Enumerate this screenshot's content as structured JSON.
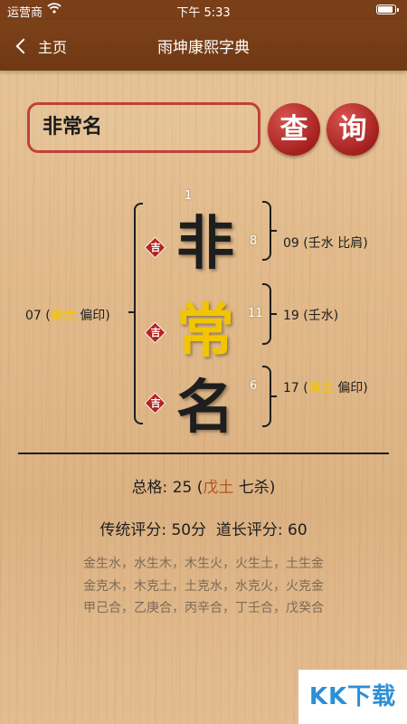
{
  "status_bar": {
    "carrier": "运营商",
    "time": "下午 5:33",
    "battery_level": 0.9
  },
  "nav": {
    "back_label": "主页",
    "title": "雨坤康熙字典"
  },
  "search": {
    "value": "非常名"
  },
  "buttons": {
    "query_1": "查",
    "query_2": "询"
  },
  "name_chars": [
    {
      "char": "非",
      "strokes": "8",
      "fortune": "吉",
      "color": "#1e1e1e"
    },
    {
      "char": "常",
      "strokes": "11",
      "fortune": "吉",
      "color": "#f2c500"
    },
    {
      "char": "名",
      "strokes": "6",
      "fortune": "吉",
      "color": "#1e1e1e"
    }
  ],
  "top_stroke": "1",
  "grids": {
    "outer": {
      "num": "07",
      "wuxing": "庚金",
      "shishen": "偏印"
    },
    "tian": {
      "num": "09",
      "wuxing": "壬水",
      "shishen": "比肩"
    },
    "ren": {
      "num": "19",
      "wuxing": "壬水"
    },
    "di": {
      "num": "17",
      "wuxing": "庚金",
      "shishen": "偏印"
    }
  },
  "total": {
    "label": "总格:",
    "num": "25",
    "wuxing": "戊土",
    "shishen": "七杀"
  },
  "scores": {
    "traditional": "传统评分: 50分",
    "daochang": "道长评分: 60"
  },
  "relations": [
    "金生水，水生木，木生火，火生土，土生金",
    "金克木，木克土，土克水，水克火，火克金",
    "甲己合，乙庚合，丙辛合，丁壬合，戊癸合"
  ],
  "watermark": "KK下载",
  "colors": {
    "nav": "#7b4119",
    "accent_red": "#b5251e",
    "gold": "#f2c500",
    "earth": "#b3541e"
  }
}
